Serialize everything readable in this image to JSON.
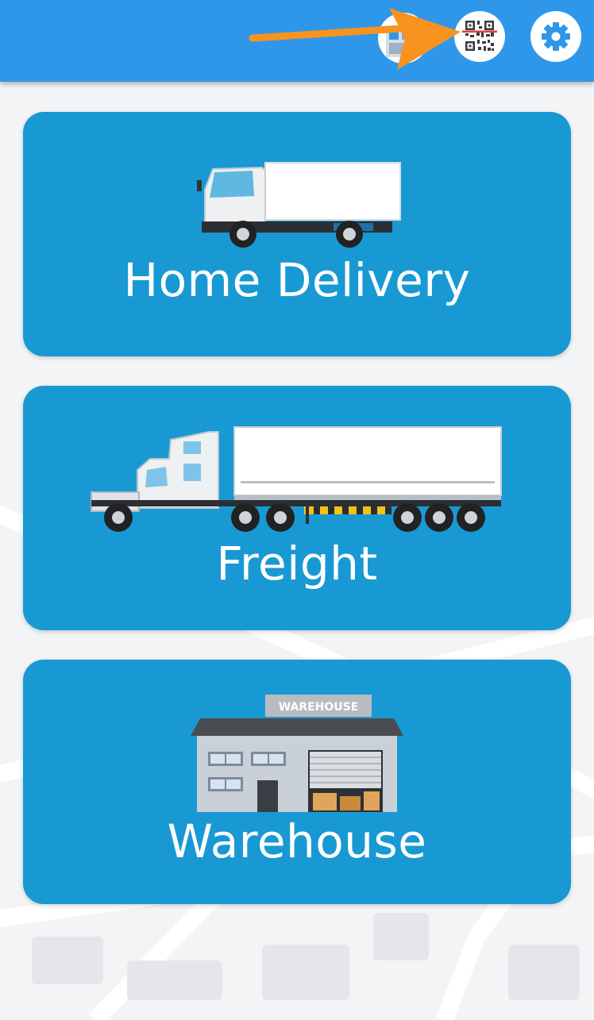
{
  "header": {
    "background_color": "#2f97ea",
    "icons": [
      "nav-icon",
      "qr-code-icon",
      "gear-icon"
    ]
  },
  "annotation": {
    "color": "#f7931e",
    "type": "arrow-pointing-right"
  },
  "cards": [
    {
      "label": "Home Delivery",
      "icon": "delivery-truck-icon",
      "color": "#1899d4"
    },
    {
      "label": "Freight",
      "icon": "semi-truck-icon",
      "color": "#1899d4"
    },
    {
      "label": "Warehouse",
      "icon": "warehouse-icon",
      "color": "#1899d4",
      "sign_text": "WAREHOUSE"
    }
  ]
}
